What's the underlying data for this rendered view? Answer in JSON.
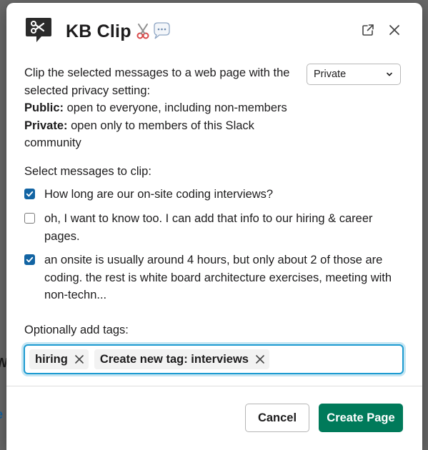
{
  "colors": {
    "accent_blue": "#1264a3",
    "focus_ring": "#1d9bd1",
    "primary_green": "#007a5a",
    "text": "#1d1c1d"
  },
  "dialog": {
    "title": "KB Clip",
    "icons": {
      "app": "scissors-speech-bubble-icon",
      "title_emoji": "scissors-and-speech-balloon-emoji",
      "external": "external-link-icon",
      "close": "close-icon"
    },
    "description": {
      "intro": "Clip the selected messages to a web page with the selected privacy setting:",
      "public_label": "Public:",
      "public_text": " open to everyone, including non-members",
      "private_label": "Private:",
      "private_text": " open only to members of this Slack community"
    },
    "privacy_select": {
      "value": "Private"
    },
    "messages_label": "Select messages to clip:",
    "messages": [
      {
        "checked": true,
        "text": "How long are our on-site coding interviews?"
      },
      {
        "checked": false,
        "text": "oh, I want to know too.  I can add that info to our hiring & career pages."
      },
      {
        "checked": true,
        "text": "an onsite is usually around 4 hours, but only about 2 of those are coding.  the rest is white board architecture exercises, meeting with non-techn..."
      }
    ],
    "tags_label": "Optionally add tags:",
    "tags": [
      {
        "label": "hiring"
      },
      {
        "label": "Create new tag: interviews"
      }
    ],
    "buttons": {
      "cancel": "Cancel",
      "create": "Create Page"
    }
  }
}
